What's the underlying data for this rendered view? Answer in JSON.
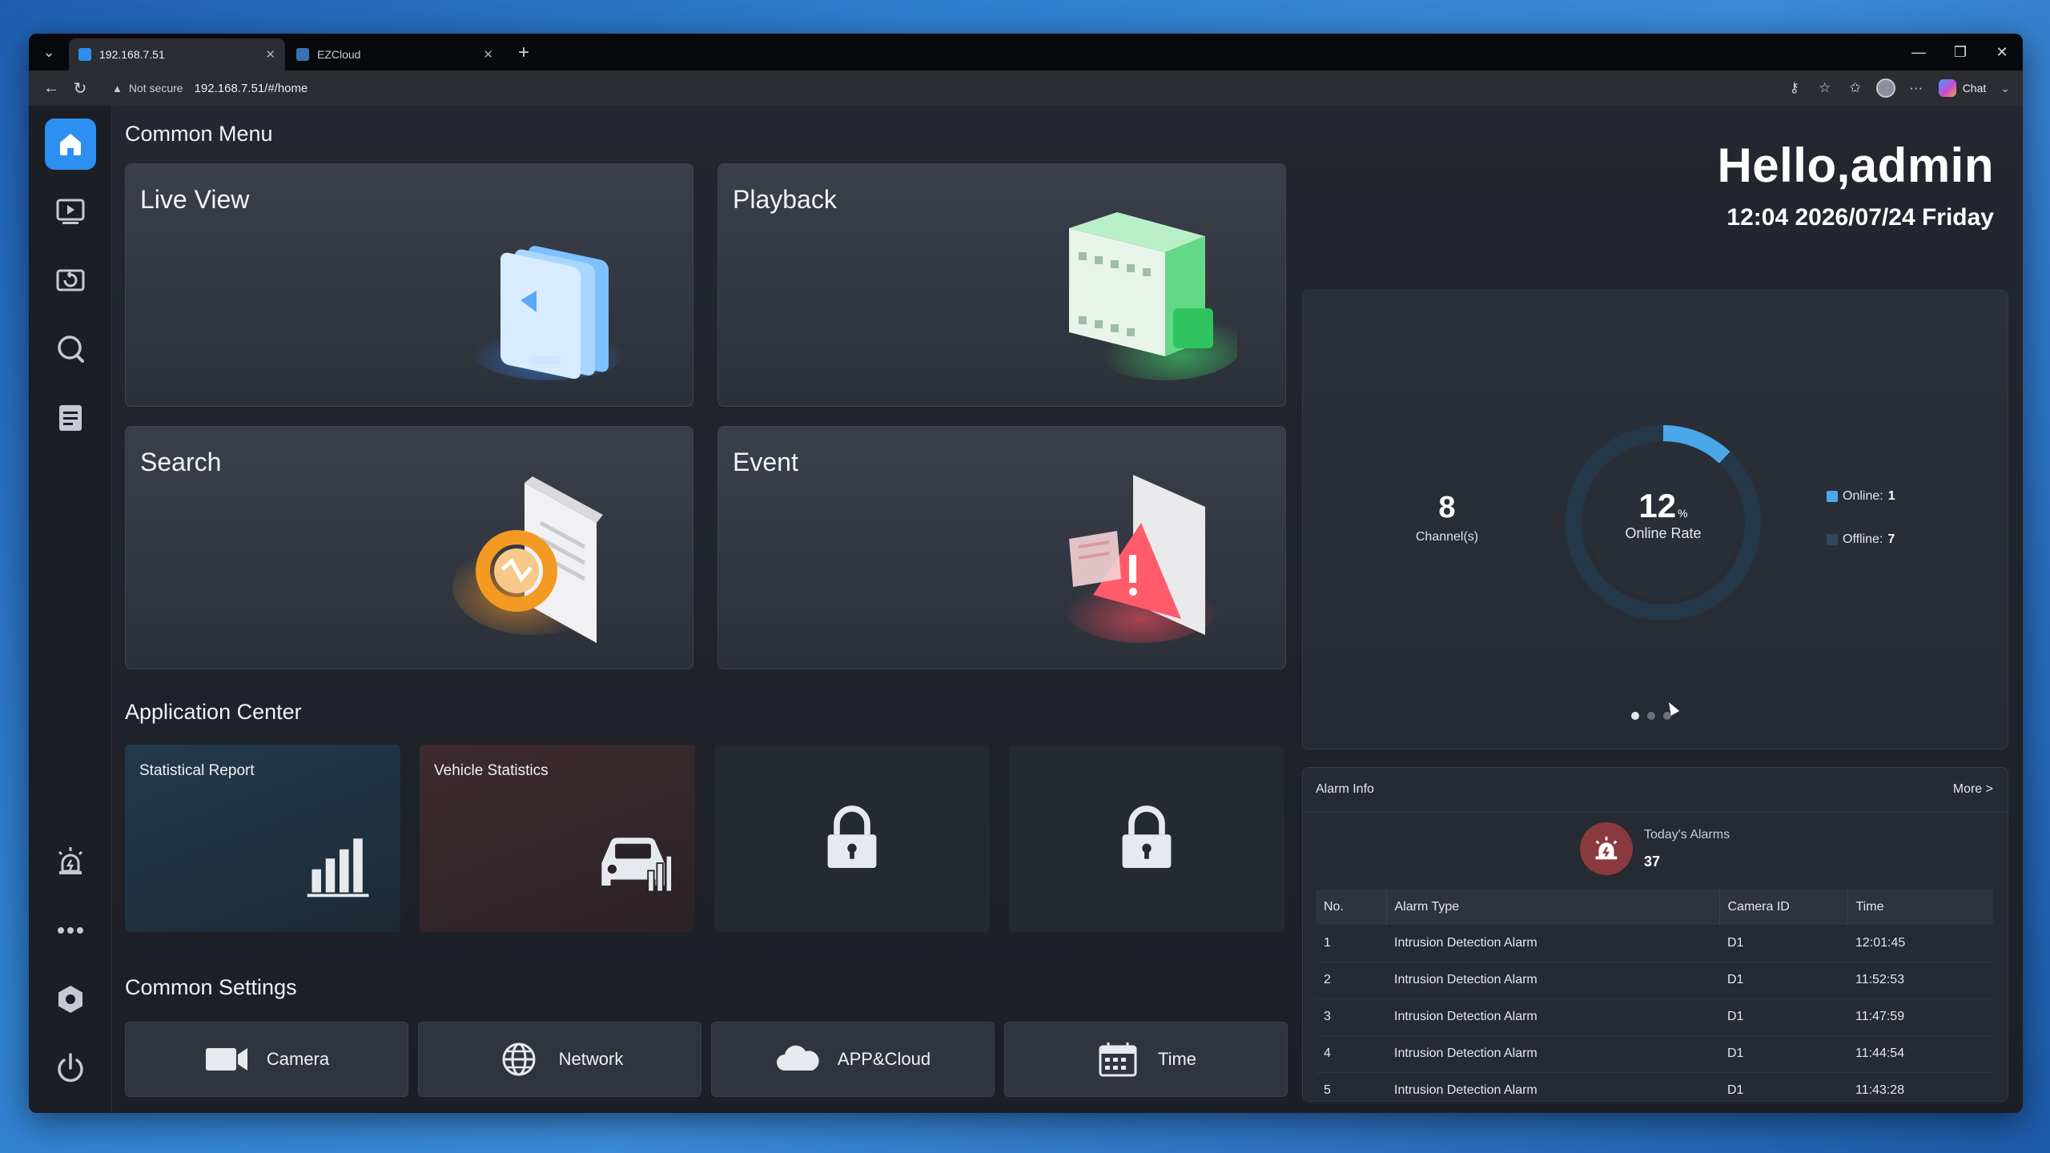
{
  "browser": {
    "tabs": [
      {
        "title": "192.168.7.51",
        "active": true
      },
      {
        "title": "EZCloud",
        "active": false
      }
    ],
    "address": {
      "security_label": "Not secure",
      "url": "192.168.7.51/#/home"
    },
    "chat_label": "Chat"
  },
  "sidebar": {
    "items": [
      {
        "icon": "home-icon",
        "active": true
      },
      {
        "icon": "live-view-icon",
        "active": false
      },
      {
        "icon": "playback-icon",
        "active": false
      },
      {
        "icon": "search-icon",
        "active": false
      },
      {
        "icon": "log-icon",
        "active": false
      },
      {
        "icon": "alarm-icon",
        "active": false
      },
      {
        "icon": "more-icon",
        "active": false
      },
      {
        "icon": "settings-icon",
        "active": false
      },
      {
        "icon": "power-icon",
        "active": false
      }
    ]
  },
  "common_menu": {
    "title": "Common Menu",
    "cards": [
      {
        "label": "Live View",
        "icon": "monitor-stack-icon"
      },
      {
        "label": "Playback",
        "icon": "film-icon"
      },
      {
        "label": "Search",
        "icon": "document-search-icon"
      },
      {
        "label": "Event",
        "icon": "warning-document-icon"
      }
    ]
  },
  "application_center": {
    "title": "Application Center",
    "cards": [
      {
        "label": "Statistical Report",
        "icon": "bar-chart-icon",
        "locked": false
      },
      {
        "label": "Vehicle Statistics",
        "icon": "car-chart-icon",
        "locked": false
      },
      {
        "label": "",
        "icon": "lock-icon",
        "locked": true
      },
      {
        "label": "",
        "icon": "lock-icon",
        "locked": true
      }
    ]
  },
  "common_settings": {
    "title": "Common Settings",
    "buttons": [
      {
        "label": "Camera",
        "icon": "camera-icon"
      },
      {
        "label": "Network",
        "icon": "globe-icon"
      },
      {
        "label": "APP&Cloud",
        "icon": "cloud-icon"
      },
      {
        "label": "Time",
        "icon": "calendar-icon"
      }
    ]
  },
  "greeting": {
    "hello": "Hello,admin",
    "datetime": "12:04 2026/07/24 Friday"
  },
  "status": {
    "channels": "8",
    "channels_label": "Channel(s)",
    "online_rate": "12",
    "online_rate_unit": "%",
    "online_rate_label": "Online Rate",
    "online_label": "Online:",
    "online_count": "1",
    "offline_label": "Offline:",
    "offline_count": "7",
    "colors": {
      "online": "#4aa8e8",
      "offline": "#2f4a5e",
      "ring": "#25384a"
    },
    "carousel_pages": 3,
    "carousel_active": 0
  },
  "alarm_info": {
    "title": "Alarm Info",
    "more": "More  >",
    "today_label": "Today's Alarms",
    "today_count": "37",
    "columns": [
      "No.",
      "Alarm Type",
      "Camera ID",
      "Time"
    ],
    "rows": [
      [
        "1",
        "Intrusion Detection Alarm",
        "D1",
        "12:01:45"
      ],
      [
        "2",
        "Intrusion Detection Alarm",
        "D1",
        "11:52:53"
      ],
      [
        "3",
        "Intrusion Detection Alarm",
        "D1",
        "11:47:59"
      ],
      [
        "4",
        "Intrusion Detection Alarm",
        "D1",
        "11:44:54"
      ],
      [
        "5",
        "Intrusion Detection Alarm",
        "D1",
        "11:43:28"
      ]
    ]
  }
}
